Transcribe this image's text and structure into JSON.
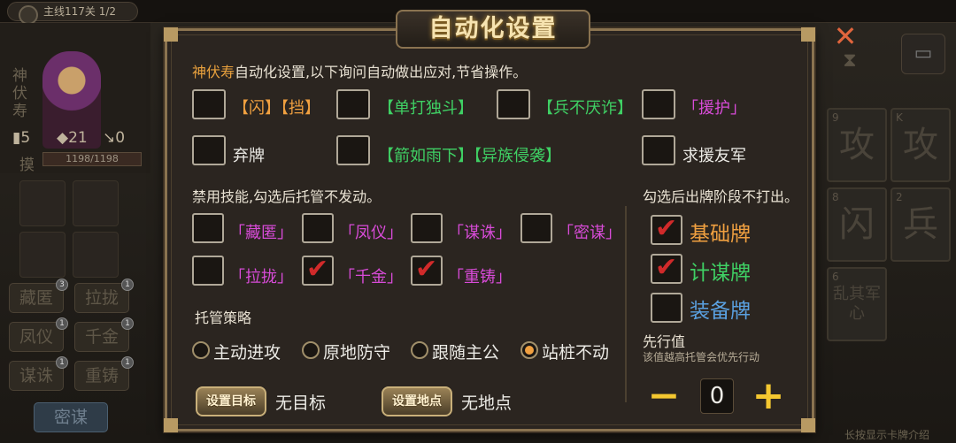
{
  "background": {
    "level_text": "主线117关 1/2",
    "hero_name": "神伏寿",
    "stats": {
      "cards": "5",
      "attack": "21",
      "other": "0"
    },
    "hp_label": "摸",
    "hp_text": "1198/1198",
    "skills": [
      {
        "label": "藏匿",
        "badge": "3"
      },
      {
        "label": "拉拢",
        "badge": "1"
      },
      {
        "label": "凤仪",
        "badge": "1"
      },
      {
        "label": "千金",
        "badge": "1"
      },
      {
        "label": "谋诛",
        "badge": "1"
      },
      {
        "label": "重铸",
        "badge": "1"
      }
    ],
    "secret_button": "密谋",
    "cards": [
      {
        "text": "攻",
        "corner": "9"
      },
      {
        "text": "攻",
        "corner": "K"
      },
      {
        "text": "闪",
        "corner": "8"
      },
      {
        "text": "兵",
        "corner": "2"
      },
      {
        "text": "乱其军心",
        "corner": "6"
      }
    ],
    "hint": "长按显示卡牌介绍"
  },
  "dialog": {
    "title": "自动化设置",
    "intro_highlight": "神伏寿",
    "intro_rest": "自动化设置,以下询问自动做出应对,节省操作。",
    "auto_responses": [
      {
        "label": "【闪】【挡】",
        "color": "orange",
        "checked": false
      },
      {
        "label": "【单打独斗】",
        "color": "green",
        "checked": false
      },
      {
        "label": "【兵不厌诈】",
        "color": "green",
        "checked": false
      },
      {
        "label": "「援护」",
        "color": "purple",
        "checked": false
      },
      {
        "label": "弃牌",
        "color": "white",
        "checked": false
      },
      {
        "label": "【箭如雨下】【异族侵袭】",
        "color": "green",
        "checked": false
      },
      {
        "label": "求援友军",
        "color": "white",
        "checked": false
      }
    ],
    "disable_heading": "禁用技能,勾选后托管不发动。",
    "disabled_skills": [
      {
        "label": "「藏匿」",
        "checked": false
      },
      {
        "label": "「凤仪」",
        "checked": false
      },
      {
        "label": "「谋诛」",
        "checked": false
      },
      {
        "label": "「密谋」",
        "checked": false
      },
      {
        "label": "「拉拢」",
        "checked": false
      },
      {
        "label": "「千金」",
        "checked": true
      },
      {
        "label": "「重铸」",
        "checked": true
      }
    ],
    "strategy_heading": "托管策略",
    "strategies": [
      {
        "label": "主动进攻",
        "selected": false
      },
      {
        "label": "原地防守",
        "selected": false
      },
      {
        "label": "跟随主公",
        "selected": false
      },
      {
        "label": "站桩不动",
        "selected": true
      }
    ],
    "target_button": "设置目标",
    "target_value": "无目标",
    "location_button": "设置地点",
    "location_value": "无地点",
    "no_play_heading": "勾选后出牌阶段不打出。",
    "no_play_cards": [
      {
        "label": "基础牌",
        "color": "#f0a040",
        "checked": true
      },
      {
        "label": "计谋牌",
        "color": "#3fd064",
        "checked": true
      },
      {
        "label": "装备牌",
        "color": "#5aa0e0",
        "checked": false
      }
    ],
    "initiative_label": "先行值",
    "initiative_desc": "该值越高托管会优先行动",
    "initiative_value": "0",
    "minus": "−",
    "plus": "+"
  }
}
